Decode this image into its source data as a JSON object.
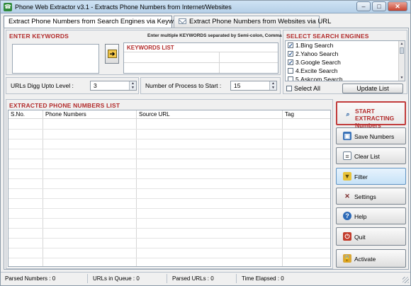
{
  "window": {
    "title": "Phone Web Extractor v3.1 - Extracts Phone Numbers from Internet/Websites",
    "buttons": {
      "minimize": "–",
      "maximize": "□",
      "close": "✕"
    }
  },
  "tabs": [
    {
      "label": "Extract Phone Numbers from Search Engines via Keywords",
      "active": true
    },
    {
      "label": "Extract Phone Numbers from Websites via URL",
      "active": false
    }
  ],
  "keywords": {
    "title": "ENTER KEYWORDS",
    "hint": "Enter multiple KEYWORDS separated by Semi-colon, Comma",
    "input_value": "",
    "add_arrow": "➔",
    "list_title": "KEYWORDS LIST"
  },
  "settings": {
    "urls_digg_label": "URLs Digg Upto Level :",
    "urls_digg_value": "3",
    "process_label": "Number of Process to Start :",
    "process_value": "15"
  },
  "engines": {
    "title": "SELECT SEARCH ENGINES",
    "items": [
      {
        "label": "1.Bing Search",
        "checked": true
      },
      {
        "label": "2.Yahoo Search",
        "checked": true
      },
      {
        "label": "3.Google Search",
        "checked": true
      },
      {
        "label": "4.Excite Search",
        "checked": false
      },
      {
        "label": "5.Askcom Search",
        "checked": false
      }
    ],
    "select_all_label": "Select All",
    "select_all_checked": false,
    "update_label": "Update List"
  },
  "results": {
    "title": "EXTRACTED PHONE NUMBERS LIST",
    "columns": [
      "S.No.",
      "Phone Numbers",
      "Source URL",
      "Tag"
    ],
    "rows": []
  },
  "actions": [
    {
      "label": "START EXTRACTING Numbers",
      "icon": "search-icon"
    },
    {
      "label": "Save Numbers",
      "icon": "save-icon"
    },
    {
      "label": "Clear List",
      "icon": "clear-icon"
    },
    {
      "label": "Filter",
      "icon": "filter-icon"
    },
    {
      "label": "Settings",
      "icon": "settings-icon"
    },
    {
      "label": "Help",
      "icon": "help-icon"
    },
    {
      "label": "Quit",
      "icon": "quit-icon"
    },
    {
      "label": "Activate",
      "icon": "activate-icon"
    }
  ],
  "status": {
    "parsed_numbers": "Parsed Numbers : 0",
    "urls_in_queue": "URLs in Queue : 0",
    "parsed_urls": "Parsed URLs : 0",
    "time_elapsed": "Time Elapsed : 0"
  }
}
